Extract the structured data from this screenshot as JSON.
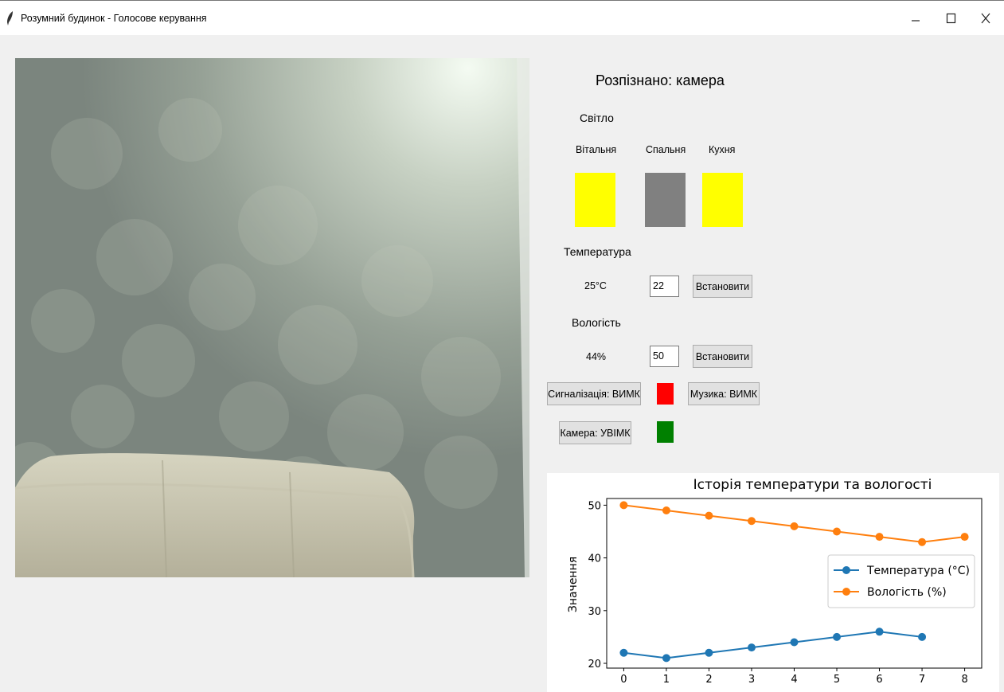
{
  "window": {
    "title": "Розумний будинок - Голосове керування",
    "minimize_glyph": "–",
    "maximize_glyph": "☐",
    "close_glyph": "X"
  },
  "status": {
    "recognized": "Розпізнано: камера"
  },
  "lights": {
    "section_label": "Світло",
    "rooms": [
      {
        "name": "Вітальня",
        "state_color": "#ffff00"
      },
      {
        "name": "Спальня",
        "state_color": "#808080"
      },
      {
        "name": "Кухня",
        "state_color": "#ffff00"
      }
    ]
  },
  "temperature": {
    "section_label": "Температура",
    "current": "25°C",
    "input_value": "22",
    "set_button": "Встановити"
  },
  "humidity": {
    "section_label": "Вологість",
    "current": "44%",
    "input_value": "50",
    "set_button": "Встановити"
  },
  "alarm": {
    "button_label": "Сигналізація: ВИМК",
    "indicator_color": "#ff0000"
  },
  "music": {
    "button_label": "Музика: ВИМК"
  },
  "camera": {
    "button_label": "Камера: УВІМК",
    "indicator_color": "#008000"
  },
  "chart_data": {
    "type": "line",
    "title": "Історія температури та вологості",
    "xlabel": "",
    "ylabel": "Значення",
    "xlim": [
      0,
      8
    ],
    "ylim": [
      20,
      51
    ],
    "x_ticks": [
      0,
      1,
      2,
      3,
      4,
      5,
      6,
      7,
      8
    ],
    "y_ticks": [
      20,
      30,
      40,
      50
    ],
    "grid": false,
    "legend_position": "center-right",
    "series": [
      {
        "name": "Температура (°C)",
        "color": "#1f77b4",
        "x": [
          0,
          1,
          2,
          3,
          4,
          5,
          6,
          7
        ],
        "values": [
          22,
          21,
          22,
          23,
          24,
          25,
          26,
          25
        ]
      },
      {
        "name": "Вологість (%)",
        "color": "#ff7f0e",
        "x": [
          0,
          1,
          2,
          3,
          4,
          5,
          6,
          7,
          8
        ],
        "values": [
          50,
          49,
          48,
          47,
          46,
          45,
          44,
          43,
          44
        ]
      }
    ]
  }
}
